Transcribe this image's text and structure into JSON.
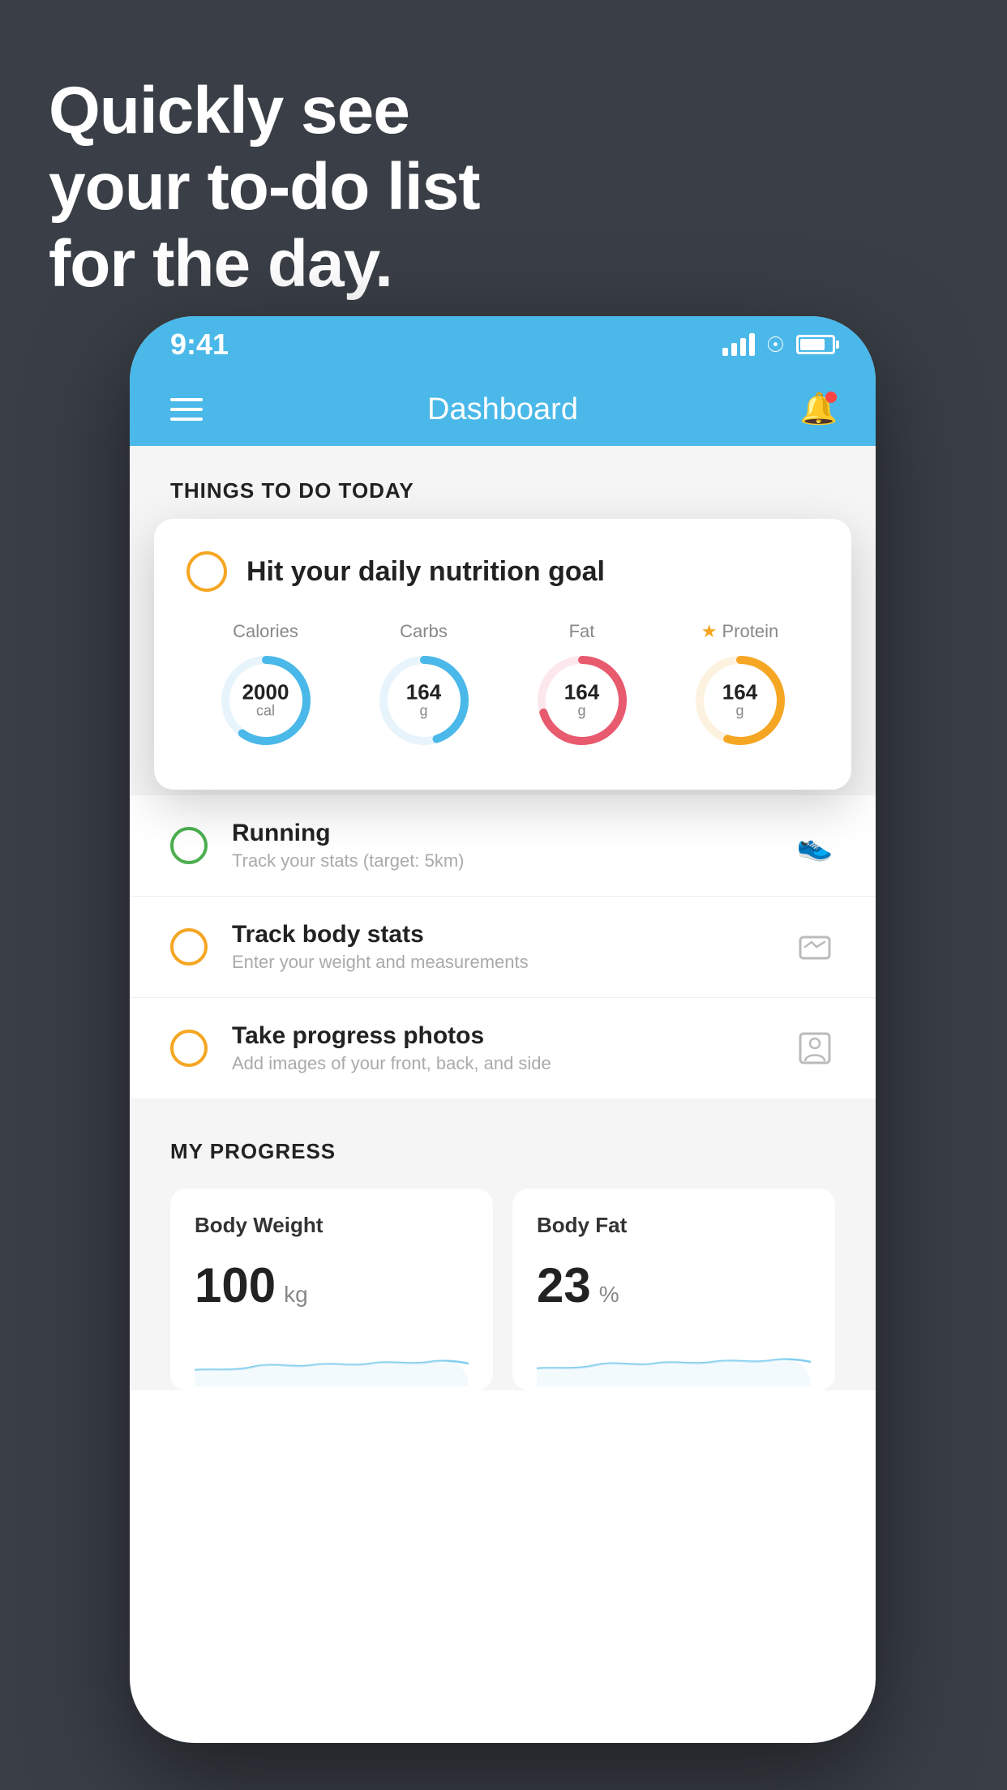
{
  "headline": {
    "line1": "Quickly see",
    "line2": "your to-do list",
    "line3": "for the day."
  },
  "status_bar": {
    "time": "9:41",
    "signal_bars": [
      10,
      16,
      22,
      28
    ],
    "wifi": "wifi",
    "battery": 80
  },
  "app_header": {
    "title": "Dashboard"
  },
  "things_section": {
    "title": "THINGS TO DO TODAY"
  },
  "floating_card": {
    "title": "Hit your daily nutrition goal",
    "nutrition": [
      {
        "label": "Calories",
        "value": "2000",
        "unit": "cal",
        "color": "#4ab8e8",
        "progress": 60,
        "starred": false
      },
      {
        "label": "Carbs",
        "value": "164",
        "unit": "g",
        "color": "#4ab8e8",
        "progress": 45,
        "starred": false
      },
      {
        "label": "Fat",
        "value": "164",
        "unit": "g",
        "color": "#e85a6e",
        "progress": 70,
        "starred": false
      },
      {
        "label": "Protein",
        "value": "164",
        "unit": "g",
        "color": "#f5a623",
        "progress": 55,
        "starred": true
      }
    ]
  },
  "todo_items": [
    {
      "title": "Running",
      "subtitle": "Track your stats (target: 5km)",
      "circle_color": "green",
      "icon": "shoe"
    },
    {
      "title": "Track body stats",
      "subtitle": "Enter your weight and measurements",
      "circle_color": "yellow",
      "icon": "scale"
    },
    {
      "title": "Take progress photos",
      "subtitle": "Add images of your front, back, and side",
      "circle_color": "yellow",
      "icon": "person"
    }
  ],
  "progress_section": {
    "title": "MY PROGRESS",
    "cards": [
      {
        "title": "Body Weight",
        "value": "100",
        "unit": "kg"
      },
      {
        "title": "Body Fat",
        "value": "23",
        "unit": "%"
      }
    ]
  }
}
